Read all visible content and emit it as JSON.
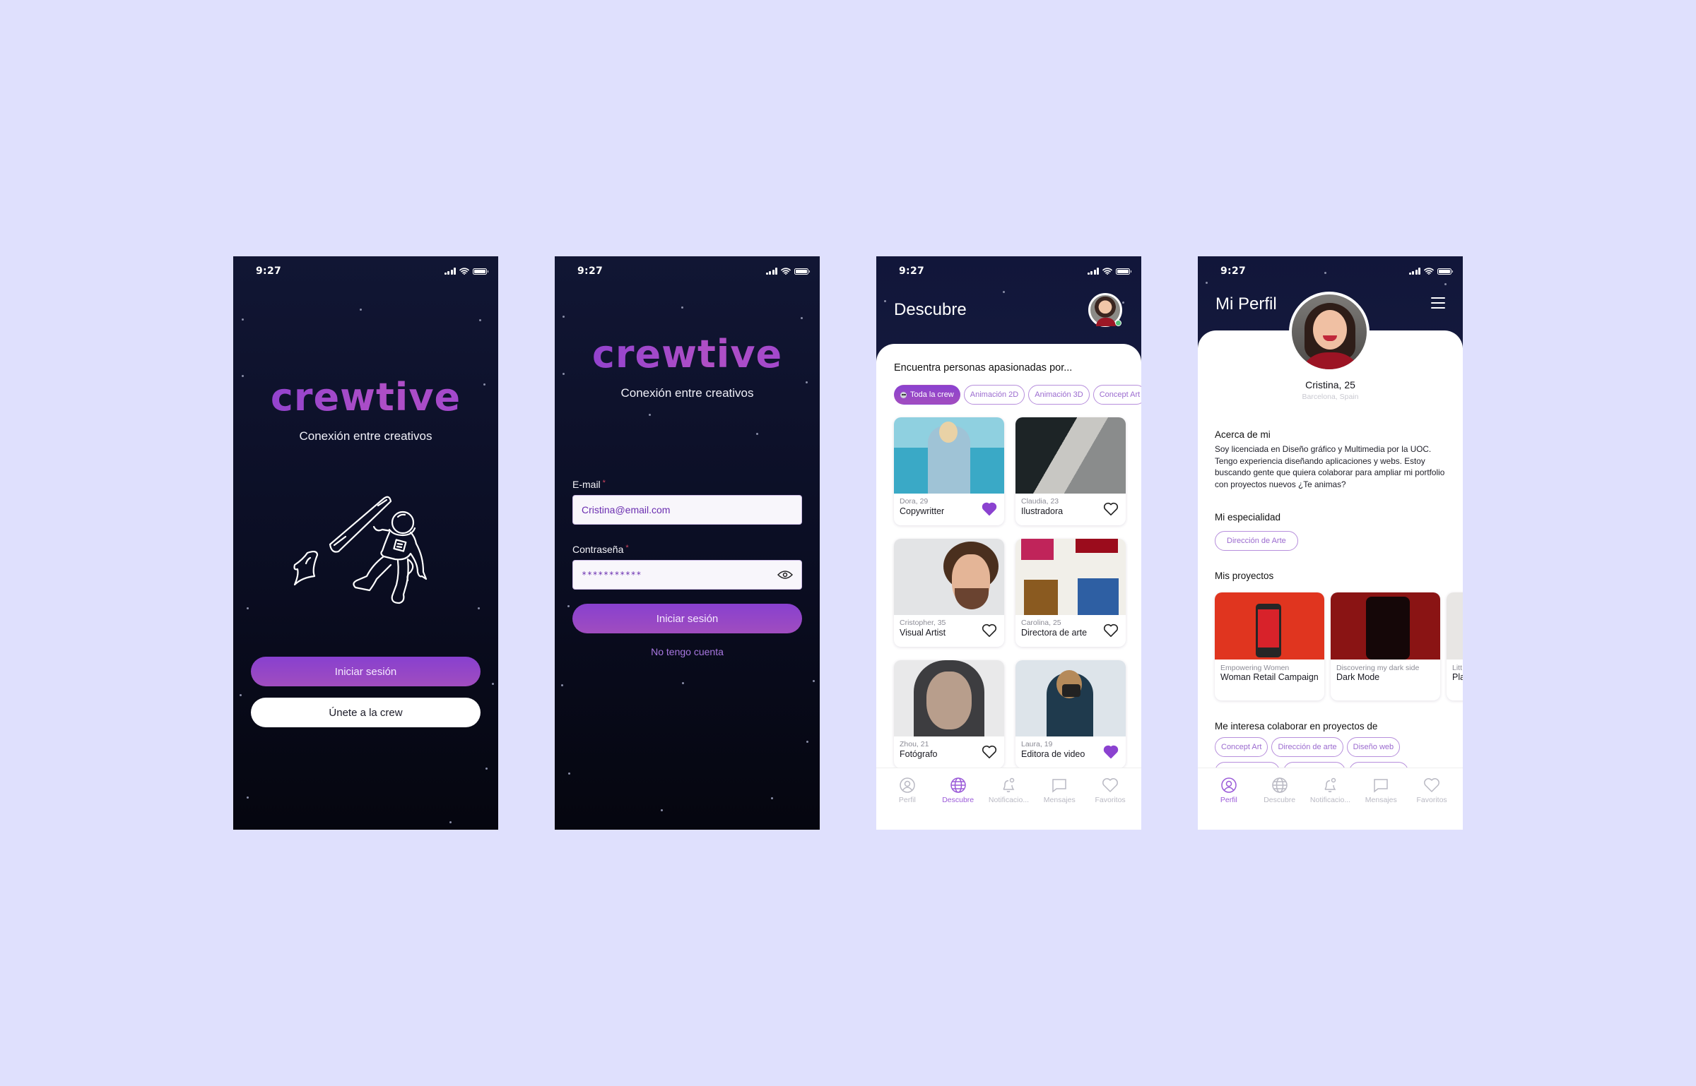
{
  "status_bar": {
    "time": "9:27"
  },
  "colors": {
    "background": "#dfe0fd",
    "dark_bg": "#0b0e24",
    "accent": "#8b42d0",
    "accent_light": "#a877e0",
    "liked_heart": "#8b42d0",
    "online": "#53c27a"
  },
  "welcome": {
    "logo": "crewtive",
    "tagline": "Conexión entre creativos",
    "illustration": "astronaut-with-pen",
    "login_button": "Iniciar sesión",
    "join_button": "Únete a la crew"
  },
  "login": {
    "logo": "crewtive",
    "tagline": "Conexión entre creativos",
    "email_label": "E-mail",
    "email_value": "Cristina@email.com",
    "password_label": "Contraseña",
    "password_value": "***********",
    "required_mark": "*",
    "submit_button": "Iniciar sesión",
    "no_account_link": "No tengo cuenta"
  },
  "discover": {
    "title": "Descubre",
    "heading": "Encuentra personas apasionadas por...",
    "chips": [
      {
        "label": "Toda la crew",
        "active": true,
        "icon": "alien-icon"
      },
      {
        "label": "Animación 2D",
        "active": false
      },
      {
        "label": "Animación 3D",
        "active": false
      },
      {
        "label": "Concept Art",
        "active": false
      }
    ],
    "people": [
      {
        "name_age": "Dora, 29",
        "role": "Copywritter",
        "liked": true
      },
      {
        "name_age": "Claudia, 23",
        "role": "Ilustradora",
        "liked": false
      },
      {
        "name_age": "Cristopher, 35",
        "role": "Visual Artist",
        "liked": false
      },
      {
        "name_age": "Carolina, 25",
        "role": "Directora de arte",
        "liked": false
      },
      {
        "name_age": "Zhou, 21",
        "role": "Fotógrafo",
        "liked": false
      },
      {
        "name_age": "Laura, 19",
        "role": "Editora de video",
        "liked": true
      }
    ],
    "active_tab": "Descubre"
  },
  "nav": {
    "items": [
      {
        "label": "Perfil",
        "icon": "user-icon"
      },
      {
        "label": "Descubre",
        "icon": "globe-icon"
      },
      {
        "label": "Notificacio...",
        "icon": "bell-icon"
      },
      {
        "label": "Mensajes",
        "icon": "chat-icon"
      },
      {
        "label": "Favoritos",
        "icon": "heart-icon"
      }
    ]
  },
  "profile": {
    "title": "Mi Perfil",
    "name_age": "Cristina, 25",
    "location": "Barcelona, Spain",
    "about_heading": "Acerca de mi",
    "about_text": "Soy licenciada en Diseño gráfico y Multimedia por la UOC. Tengo experiencia diseñando aplicaciones y webs. Estoy buscando gente que quiera colaborar para ampliar mi portfolio con proyectos nuevos ¿Te animas?",
    "specialty_heading": "Mi especialidad",
    "specialty": "Dirección de Arte",
    "projects_heading": "Mis proyectos",
    "projects": [
      {
        "subtitle": "Empowering Women",
        "title": "Woman Retail Campaign"
      },
      {
        "subtitle": "Discovering my dark side",
        "title": "Dark Mode"
      },
      {
        "subtitle": "Litt mu",
        "title": "Pla"
      }
    ],
    "interests_heading": "Me interesa colaborar en proyectos de",
    "interests": [
      "Concept Art",
      "Dirección de arte",
      "Diseño web"
    ],
    "active_tab": "Perfil"
  }
}
